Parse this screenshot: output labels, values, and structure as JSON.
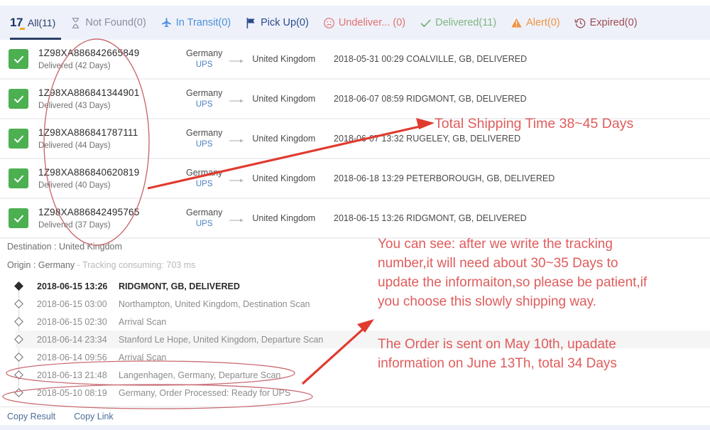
{
  "tabs": [
    {
      "id": "all",
      "logo": "17",
      "label": "All(11)",
      "icon": "17track-logo",
      "active": true
    },
    {
      "id": "not-found",
      "label": "Not Found(0)",
      "icon": "hourglass-icon",
      "active": false
    },
    {
      "id": "in-transit",
      "label": "In Transit(0)",
      "icon": "airplane-icon",
      "active": false
    },
    {
      "id": "pick-up",
      "label": "Pick Up(0)",
      "icon": "flag-icon",
      "active": false
    },
    {
      "id": "undelivered",
      "label": "Undeliver... (0)",
      "icon": "sad-face-icon",
      "active": false
    },
    {
      "id": "delivered",
      "label": "Delivered(11)",
      "icon": "check-icon",
      "active": false
    },
    {
      "id": "alert",
      "label": "Alert(0)",
      "icon": "warning-triangle-icon",
      "active": false
    },
    {
      "id": "expired",
      "label": "Expired(0)",
      "icon": "clock-rewind-icon",
      "active": false
    }
  ],
  "rows": [
    {
      "tracking_number": "1Z98XA886842665849",
      "status": "Delivered (42 Days)",
      "origin": "Germany",
      "carrier": "UPS",
      "destination": "United Kingdom",
      "last_event": "2018-05-31 00:29  COALVILLE, GB, DELIVERED"
    },
    {
      "tracking_number": "1Z98XA886841344901",
      "status": "Delivered (43 Days)",
      "origin": "Germany",
      "carrier": "UPS",
      "destination": "United Kingdom",
      "last_event": "2018-06-07 08:59  RIDGMONT, GB, DELIVERED"
    },
    {
      "tracking_number": "1Z98XA886841787111",
      "status": "Delivered (44 Days)",
      "origin": "Germany",
      "carrier": "UPS",
      "destination": "United Kingdom",
      "last_event": "2018-06-07 13:32  RUGELEY, GB, DELIVERED"
    },
    {
      "tracking_number": "1Z98XA886840620819",
      "status": "Delivered (40 Days)",
      "origin": "Germany",
      "carrier": "UPS",
      "destination": "United Kingdom",
      "last_event": "2018-06-18 13:29  PETERBOROUGH, GB, DELIVERED"
    },
    {
      "tracking_number": "1Z98XA886842495765",
      "status": "Delivered (37 Days)",
      "origin": "Germany",
      "carrier": "UPS",
      "destination": "United Kingdom",
      "last_event": "2018-06-15 13:26  RIDGMONT, GB, DELIVERED"
    }
  ],
  "detail": {
    "destination_line": "Destination : United Kingdom",
    "origin_label": "Origin : Germany",
    "origin_sep": " - ",
    "consuming": "Tracking consuming: 703 ms",
    "events": [
      {
        "time": "2018-06-15 13:26",
        "description": "RIDGMONT, GB, DELIVERED"
      },
      {
        "time": "2018-06-15 03:00",
        "description": "Northampton, United Kingdom, Destination Scan"
      },
      {
        "time": "2018-06-15 02:30",
        "description": "Arrival Scan"
      },
      {
        "time": "2018-06-14 23:34",
        "description": "Stanford Le Hope, United Kingdom, Departure Scan"
      },
      {
        "time": "2018-06-14 09:56",
        "description": "Arrival Scan"
      },
      {
        "time": "2018-06-13 21:48",
        "description": "Langenhagen, Germany, Departure Scan"
      },
      {
        "time": "2018-05-10 08:19",
        "description": "Germany, Order Processed: Ready for UPS"
      }
    ],
    "copy_result": "Copy Result",
    "copy_link": "Copy Link"
  },
  "annotations": {
    "shipping_time": "Total Shipping Time 38~45 Days",
    "explanation": "You can see: after we write the tracking\nnumber,it will need about 30~35 Days to\nupdate the informaiton,so please be patient,if\nyou choose this slowly shipping way.",
    "order_note": "The Order is sent on May 10th, upadate\ninformation on June 13Th, total 34 Days"
  },
  "colors": {
    "annotation_red": "#e05c5c",
    "ellipse_red": "#c96b72",
    "arrow_red": "#e03b2f",
    "check_green": "#4caf50",
    "tabbar_bg": "#eef1fa",
    "active_tab": "#2a3f66"
  }
}
